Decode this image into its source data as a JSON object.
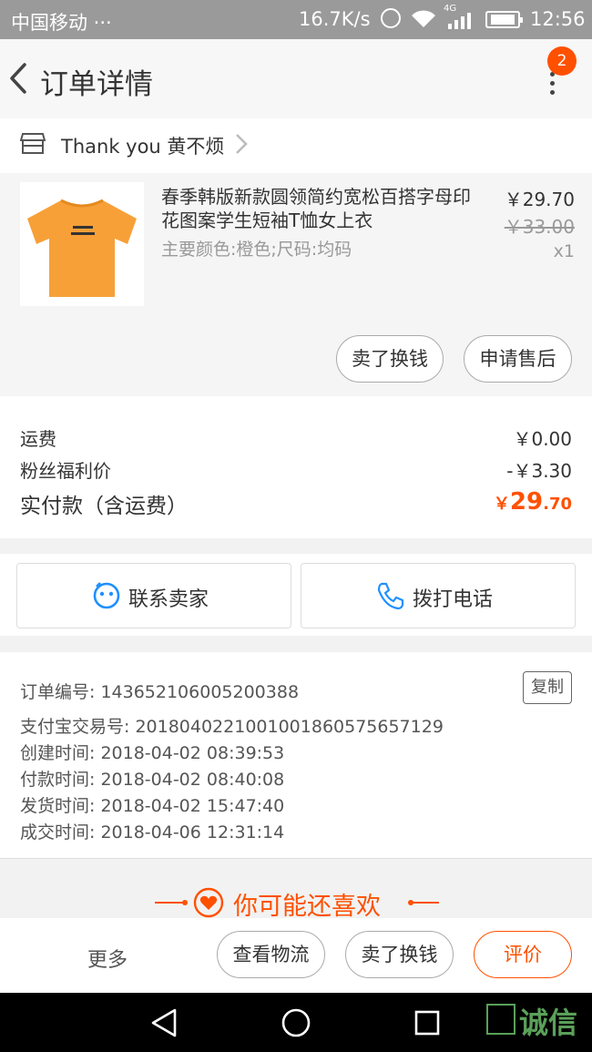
{
  "status_bar": {
    "carrier": "中国移动 ···",
    "speed": "16.7K/s",
    "network": "4G",
    "time": "12:56"
  },
  "header": {
    "title": "订单详情",
    "badge_count": "2"
  },
  "shop": {
    "name": "Thank you 黄不烦"
  },
  "product": {
    "name": "春季韩版新款圆领简约宽松百搭字母印花图案学生短袖T恤女上衣",
    "spec": "主要颜色:橙色;尺码:均码",
    "price": "￥29.70",
    "original_price": "￥33.00",
    "quantity": "x1",
    "actions": [
      "卖了换钱",
      "申请售后"
    ]
  },
  "fees": {
    "shipping_label": "运费",
    "shipping_value": "￥0.00",
    "discount_label": "粉丝福利价",
    "discount_value": "-￥3.30",
    "total_label": "实付款（含运费）",
    "total_symbol": "￥",
    "total_int": "29",
    "total_dec": ".70"
  },
  "contact": {
    "seller": "联系卖家",
    "phone": "拨打电话"
  },
  "order_info": {
    "order_no": "订单编号: 143652106005200388",
    "copy": "复制",
    "alipay_no": "支付宝交易号: 2018040221001001860575657129",
    "created": "创建时间: 2018-04-02 08:39:53",
    "paid": "付款时间: 2018-04-02 08:40:08",
    "shipped": "发货时间: 2018-04-02 15:47:40",
    "completed": "成交时间: 2018-04-06 12:31:14"
  },
  "recommend": {
    "title": "你可能还喜欢"
  },
  "action_bar": {
    "more": "更多",
    "logistics": "查看物流",
    "resell": "卖了换钱",
    "evaluate": "评价"
  },
  "watermark": {
    "text": "诚信"
  },
  "colors": {
    "accent": "#ff5000",
    "contact_icon": "#1e90ff"
  }
}
